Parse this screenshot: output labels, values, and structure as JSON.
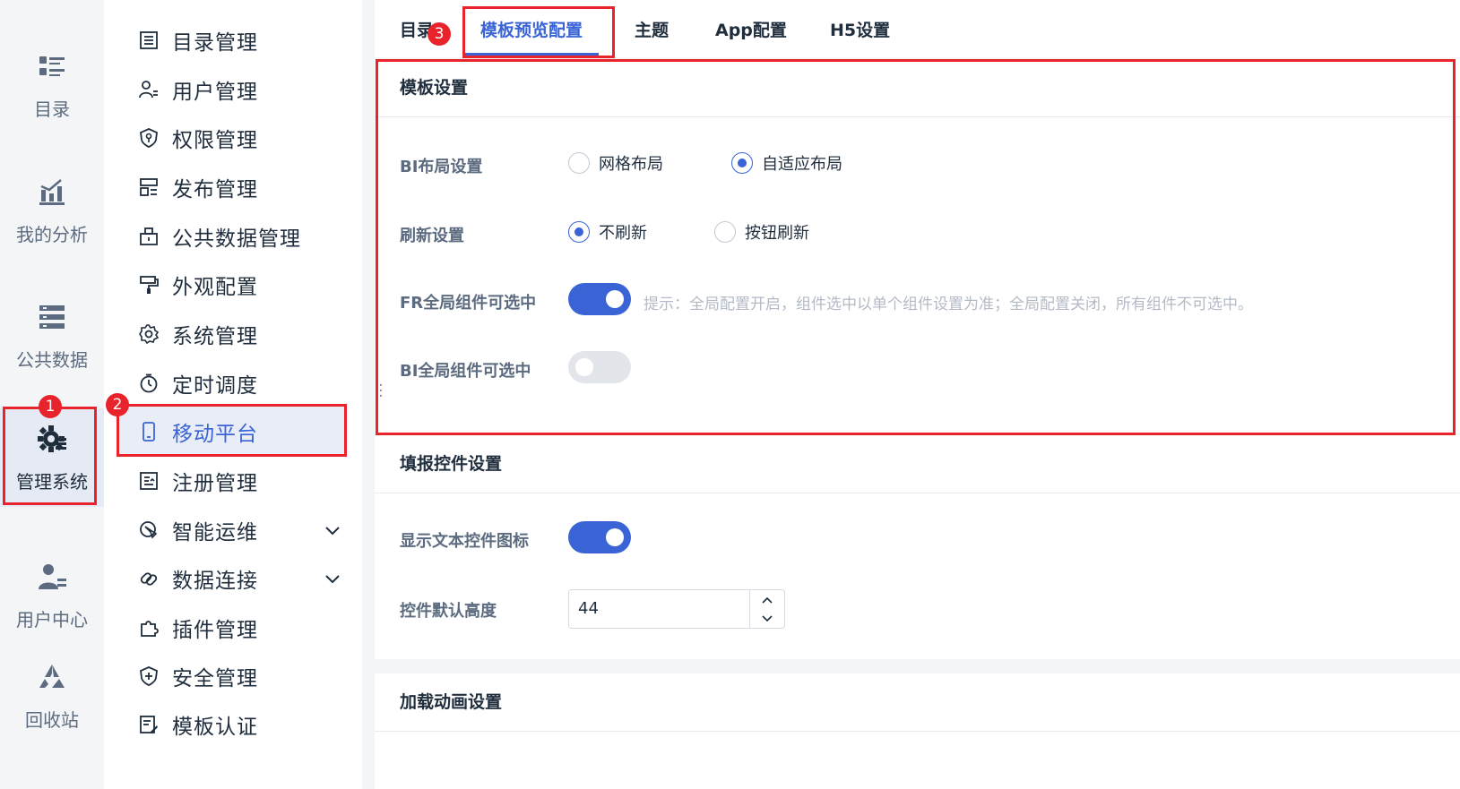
{
  "rail": {
    "items": [
      {
        "label": "目录",
        "icon": "catalog-icon"
      },
      {
        "label": "我的分析",
        "icon": "analysis-icon"
      },
      {
        "label": "公共数据",
        "icon": "database-icon"
      },
      {
        "label": "管理系统",
        "icon": "gear-icon"
      },
      {
        "label": "用户中心",
        "icon": "user-icon"
      },
      {
        "label": "回收站",
        "icon": "recycle-icon"
      }
    ]
  },
  "subnav": {
    "items": [
      {
        "label": "目录管理",
        "icon": "list-icon"
      },
      {
        "label": "用户管理",
        "icon": "user-manage-icon"
      },
      {
        "label": "权限管理",
        "icon": "shield-key-icon"
      },
      {
        "label": "发布管理",
        "icon": "publish-icon"
      },
      {
        "label": "公共数据管理",
        "icon": "public-data-icon"
      },
      {
        "label": "外观配置",
        "icon": "paint-roller-icon"
      },
      {
        "label": "系统管理",
        "icon": "settings-icon"
      },
      {
        "label": "定时调度",
        "icon": "timer-icon"
      },
      {
        "label": "移动平台",
        "icon": "mobile-icon"
      },
      {
        "label": "注册管理",
        "icon": "register-icon"
      },
      {
        "label": "智能运维",
        "icon": "ops-icon"
      },
      {
        "label": "数据连接",
        "icon": "link-icon"
      },
      {
        "label": "插件管理",
        "icon": "plugin-icon"
      },
      {
        "label": "安全管理",
        "icon": "security-icon"
      },
      {
        "label": "模板认证",
        "icon": "certify-icon"
      }
    ]
  },
  "tabs": [
    {
      "label": "目录"
    },
    {
      "label": "模板预览配置"
    },
    {
      "label": "主题"
    },
    {
      "label": "App配置"
    },
    {
      "label": "H5设置"
    }
  ],
  "template_settings": {
    "title": "模板设置",
    "bi_layout": {
      "label": "BI布局设置",
      "options": [
        "网格布局",
        "自适应布局"
      ],
      "selected": "自适应布局"
    },
    "refresh": {
      "label": "刷新设置",
      "options": [
        "不刷新",
        "按钮刷新"
      ],
      "selected": "不刷新"
    },
    "fr_selectable": {
      "label": "FR全局组件可选中",
      "on": true,
      "hint": "提示：全局配置开启，组件选中以单个组件设置为准；全局配置关闭，所有组件不可选中。"
    },
    "bi_selectable": {
      "label": "BI全局组件可选中",
      "on": false
    }
  },
  "fill_controls": {
    "title": "填报控件设置",
    "show_text_icon": {
      "label": "显示文本控件图标",
      "on": true
    },
    "default_height": {
      "label": "控件默认高度",
      "value": "44"
    }
  },
  "loading_anim": {
    "title": "加载动画设置"
  },
  "annotations": {
    "badge1": "1",
    "badge2": "2",
    "badge3": "3"
  },
  "colors": {
    "accent": "#3a64d6",
    "highlight": "#e8232b"
  }
}
